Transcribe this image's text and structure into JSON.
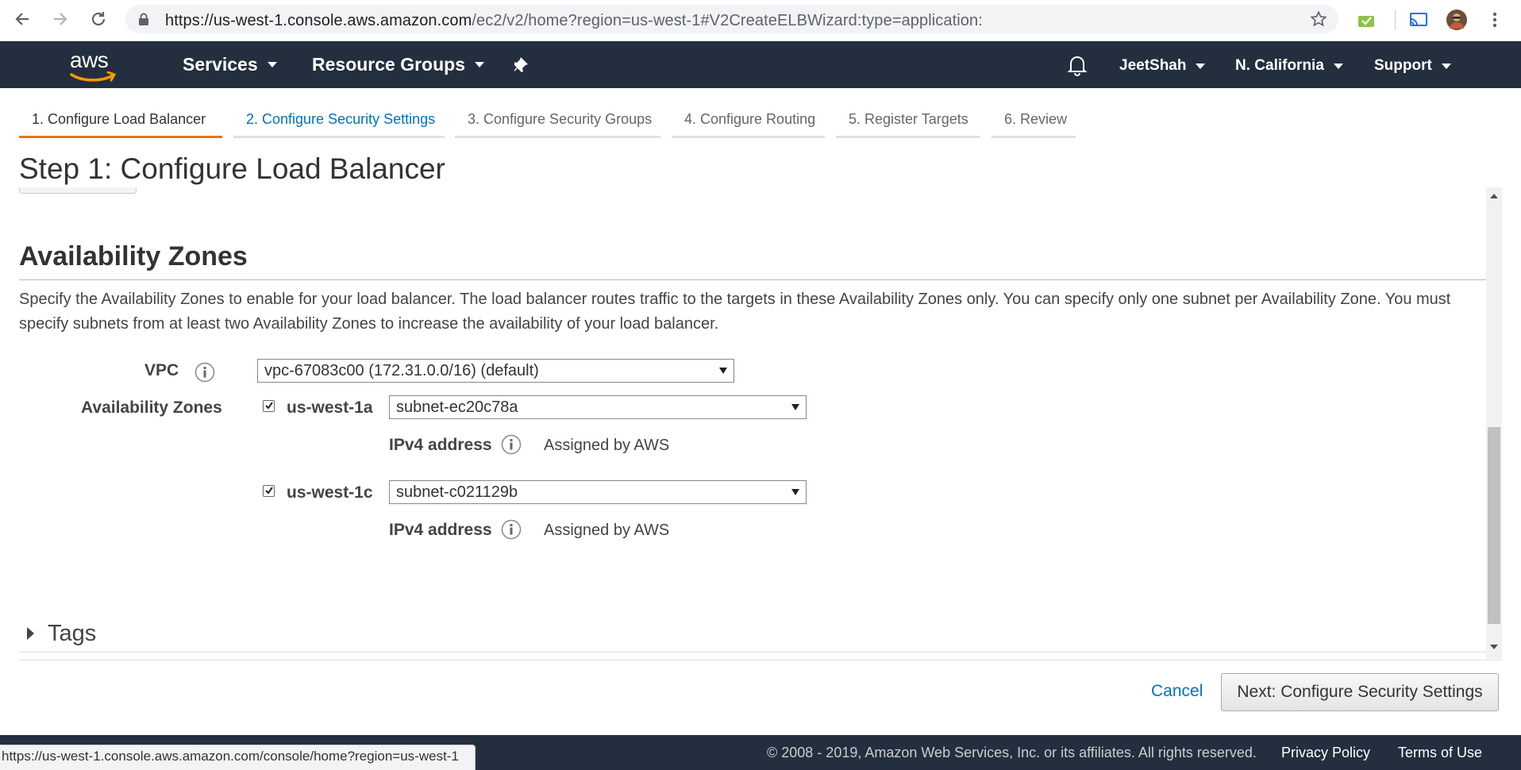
{
  "browser": {
    "url_main": "https://us-west-1.console.aws.amazon.com",
    "url_rest": "/ec2/v2/home?region=us-west-1#V2CreateELBWizard:type=application:"
  },
  "aws_nav": {
    "logo": "aws",
    "services": "Services",
    "resource_groups": "Resource Groups",
    "user": "JeetShah",
    "region": "N. California",
    "support": "Support"
  },
  "wizard": {
    "tabs": [
      {
        "label": "1. Configure Load Balancer"
      },
      {
        "label": "2. Configure Security Settings"
      },
      {
        "label": "3. Configure Security Groups"
      },
      {
        "label": "4. Configure Routing"
      },
      {
        "label": "5. Register Targets"
      },
      {
        "label": "6. Review"
      }
    ],
    "step_title": "Step 1: Configure Load Balancer"
  },
  "availability": {
    "title": "Availability Zones",
    "description": "Specify the Availability Zones to enable for your load balancer. The load balancer routes traffic to the targets in these Availability Zones only. You can specify only one subnet per Availability Zone. You must specify subnets from at least two Availability Zones to increase the availability of your load balancer.",
    "vpc_label": "VPC",
    "vpc_value": "vpc-67083c00 (172.31.0.0/16) (default)",
    "az_label": "Availability Zones",
    "zones": [
      {
        "name": "us-west-1a",
        "subnet": "subnet-ec20c78a",
        "ipv4_label": "IPv4 address",
        "ipv4_value": "Assigned by AWS",
        "checked": true
      },
      {
        "name": "us-west-1c",
        "subnet": "subnet-c021129b",
        "ipv4_label": "IPv4 address",
        "ipv4_value": "Assigned by AWS",
        "checked": true
      }
    ]
  },
  "tags": {
    "label": "Tags"
  },
  "actions": {
    "cancel": "Cancel",
    "next": "Next: Configure Security Settings"
  },
  "footer": {
    "copyright": "© 2008 - 2019, Amazon Web Services, Inc. or its affiliates. All rights reserved.",
    "privacy": "Privacy Policy",
    "terms": "Terms of Use",
    "status_url": "https://us-west-1.console.aws.amazon.com/console/home?region=us-west-1"
  },
  "colors": {
    "aws_nav_bg": "#232f3e",
    "active_tab_accent": "#ec7211",
    "link_blue": "#0073bb"
  }
}
